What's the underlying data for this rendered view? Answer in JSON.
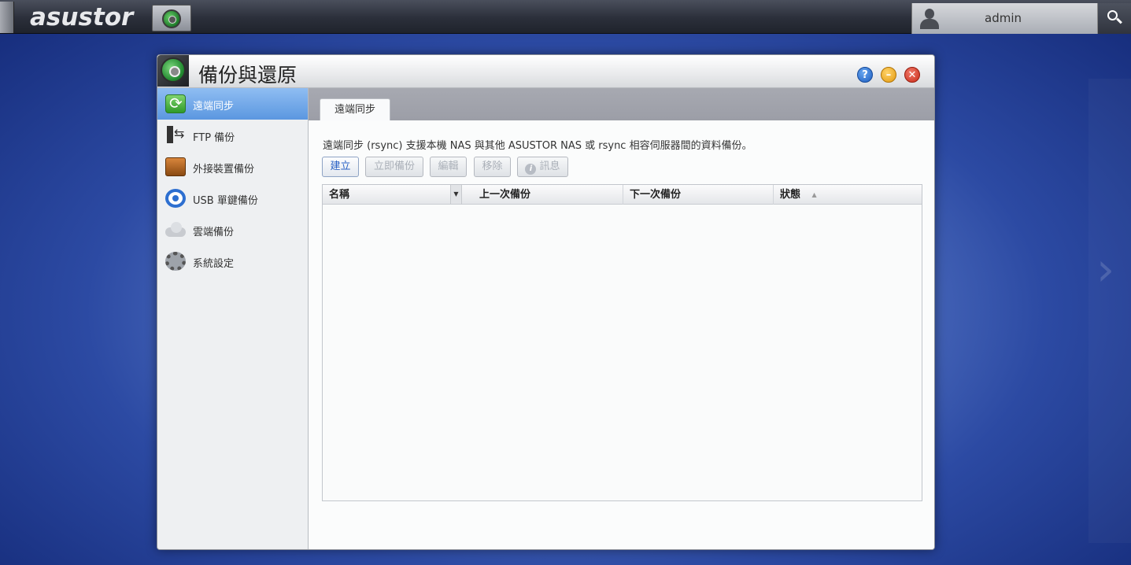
{
  "topbar": {
    "brand": "asustor",
    "user_name": "admin",
    "icons": [
      "app-backup-icon",
      "user-icon",
      "search-icon"
    ]
  },
  "window": {
    "title": "備份與還原",
    "buttons": {
      "help": "?",
      "minimize": "–",
      "close": "✕"
    }
  },
  "sidebar": {
    "items": [
      {
        "label": "遠端同步",
        "icon": "sync-icon",
        "active": true
      },
      {
        "label": "FTP 備份",
        "icon": "ftp-icon",
        "active": false
      },
      {
        "label": "外接裝置備份",
        "icon": "external-drive-icon",
        "active": false
      },
      {
        "label": "USB 單鍵備份",
        "icon": "usb-icon",
        "active": false
      },
      {
        "label": "雲端備份",
        "icon": "cloud-icon",
        "active": false
      },
      {
        "label": "系統設定",
        "icon": "gear-icon",
        "active": false
      }
    ]
  },
  "main": {
    "tab_label": "遠端同步",
    "description": "遠端同步 (rsync) 支援本機 NAS 與其他 ASUSTOR NAS 或 rsync 相容伺服器間的資料備份。",
    "toolbar": {
      "create": "建立",
      "backup_now": "立即備份",
      "edit": "編輯",
      "remove": "移除",
      "info": "訊息"
    },
    "grid": {
      "columns": [
        "名稱",
        "上一次備份",
        "下一次備份",
        "狀態"
      ],
      "rows": []
    }
  },
  "colors": {
    "accent": "#5b97e0",
    "active_text": "#2a62c5"
  }
}
